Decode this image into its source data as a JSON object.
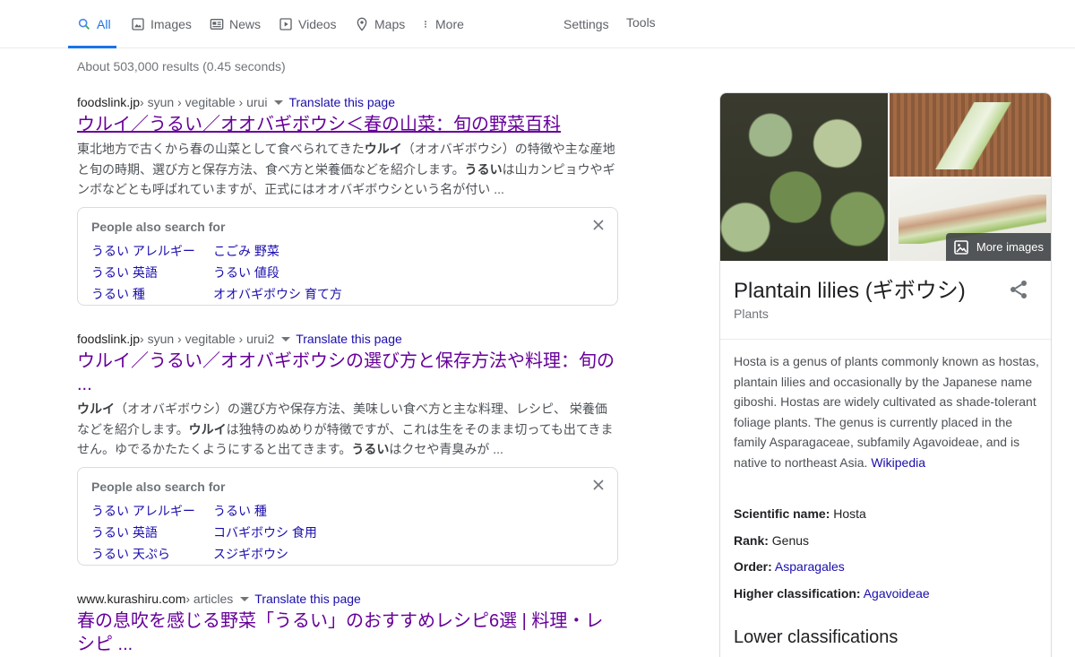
{
  "nav": {
    "tabs": [
      {
        "label": "All",
        "icon": "search-icon"
      },
      {
        "label": "Images",
        "icon": "image-icon"
      },
      {
        "label": "News",
        "icon": "newspaper-icon"
      },
      {
        "label": "Videos",
        "icon": "play-icon"
      },
      {
        "label": "Maps",
        "icon": "map-pin-icon"
      },
      {
        "label": "More",
        "icon": "more-vertical-icon"
      }
    ],
    "settings": "Settings",
    "tools": "Tools"
  },
  "stats": "About 503,000 results (0.45 seconds)",
  "results": [
    {
      "domain": "foodslink.jp",
      "path": " › syun › vegitable › urui",
      "translate": "Translate this page",
      "title": "ウルイ／うるい／オオバギボウシ＜春の山菜：旬の野菜百科",
      "snippet": [
        {
          "text": "東北地方で古くから春の山菜として食べられてきた"
        },
        {
          "text": "ウルイ",
          "bold": true
        },
        {
          "text": "（オオバギボウシ）の特徴や主な産地と旬の時期、選び方と保存方法、食べ方と栄養価などを紹介します。"
        },
        {
          "text": "うるい",
          "bold": true
        },
        {
          "text": "は山カンピョウやギンボなどとも呼ばれていますが、正式にはオオバギボウシという名が付い ..."
        }
      ]
    },
    {
      "domain": "foodslink.jp",
      "path": " › syun › vegitable › urui2",
      "translate": "Translate this page",
      "title": "ウルイ／うるい／オオバギボウシの選び方と保存方法や料理：旬の ...",
      "snippet": [
        {
          "text": "ウルイ",
          "bold": true
        },
        {
          "text": "（オオバギボウシ）の選び方や保存方法、美味しい食べ方と主な料理、レシピ、 栄養価などを紹介します。"
        },
        {
          "text": "ウルイ",
          "bold": true
        },
        {
          "text": "は独特のぬめりが特徴ですが、これは生をそのまま切っても出てきません。ゆでるかたたくようにすると出てきます。"
        },
        {
          "text": "うるい",
          "bold": true
        },
        {
          "text": "はクセや青臭みが ..."
        }
      ]
    },
    {
      "domain": "www.kurashiru.com",
      "path": " › articles",
      "translate": "Translate this page",
      "title": "春の息吹を感じる野菜「うるい」のおすすめレシピ6選 | 料理・レシピ ..."
    }
  ],
  "pasf": [
    {
      "title": "People also search for",
      "items": [
        "うるい アレルギー",
        "こごみ 野菜",
        "うるい 英語",
        "うるい 値段",
        "うるい 種",
        "オオバギボウシ 育て方"
      ]
    },
    {
      "title": "People also search for",
      "items": [
        "うるい アレルギー",
        "うるい 種",
        "うるい 英語",
        "コバギボウシ 食用",
        "うるい 天ぷら",
        "スジギボウシ"
      ]
    }
  ],
  "knowledge_panel": {
    "more_images": "More images",
    "title": "Plantain lilies (ギボウシ)",
    "subtitle": "Plants",
    "description": "Hosta is a genus of plants commonly known as hostas, plantain lilies and occasionally by the Japanese name giboshi. Hostas are widely cultivated as shade-tolerant foliage plants. The genus is currently placed in the family Asparagaceae, subfamily Agavoideae, and is native to northeast Asia.",
    "source": "Wikipedia",
    "facts": [
      {
        "label": "Scientific name:",
        "value": "Hosta",
        "link": false
      },
      {
        "label": "Rank:",
        "value": "Genus",
        "link": false
      },
      {
        "label": "Order:",
        "value": "Asparagales",
        "link": true
      },
      {
        "label": "Higher classification:",
        "value": "Agavoideae",
        "link": true
      }
    ],
    "lower_heading": "Lower classifications"
  },
  "colors": {
    "link": "#1a0dab",
    "visited": "#660099",
    "accent": "#1a73e8"
  }
}
